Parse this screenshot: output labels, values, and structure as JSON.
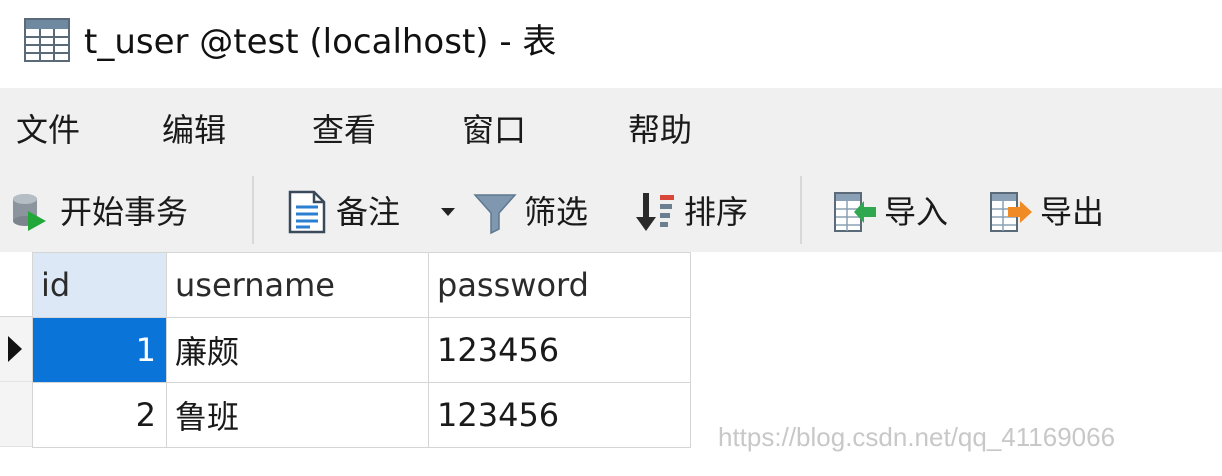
{
  "window": {
    "title": "t_user @test (localhost) - 表",
    "icon": "table-icon"
  },
  "menu": {
    "items": [
      "文件",
      "编辑",
      "查看",
      "窗口",
      "帮助"
    ]
  },
  "toolbar": {
    "begin_transaction": "开始事务",
    "memo": "备注",
    "filter": "筛选",
    "sort": "排序",
    "import": "导入",
    "export": "导出"
  },
  "grid": {
    "columns": [
      "id",
      "username",
      "password"
    ],
    "rows": [
      {
        "id": "1",
        "username": "廉颇",
        "password": "123456"
      },
      {
        "id": "2",
        "username": "鲁班",
        "password": "123456"
      }
    ],
    "selected_row": 0
  },
  "watermark": "https://blog.csdn.net/qq_41169066",
  "colors": {
    "selection": "#0a74d9",
    "header_active": "#dce8f6",
    "toolbar_bg": "#f0f0f0"
  }
}
